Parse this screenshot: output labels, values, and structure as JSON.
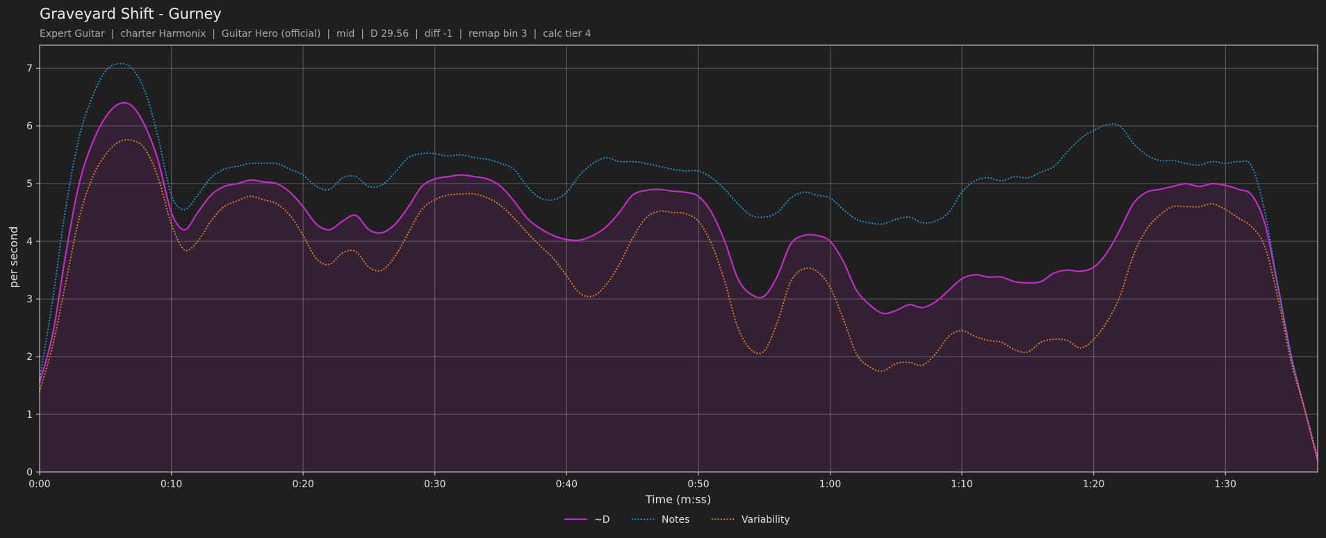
{
  "chart_data": {
    "type": "line",
    "title": "Graveyard Shift - Gurney",
    "subtitle": "Expert Guitar  |  charter Harmonix  |  Guitar Hero (official)  |  mid  |  D 29.56  |  diff -1  |  remap bin 3  |  calc tier 4",
    "xlabel": "Time (m:ss)",
    "ylabel": "per second",
    "xlim": [
      0,
      97
    ],
    "ylim": [
      0,
      7.4
    ],
    "x_ticks": [
      0,
      10,
      20,
      30,
      40,
      50,
      60,
      70,
      80,
      90
    ],
    "x_tick_labels": [
      "0:00",
      "0:10",
      "0:20",
      "0:30",
      "0:40",
      "0:50",
      "1:00",
      "1:10",
      "1:20",
      "1:30"
    ],
    "y_ticks": [
      0,
      1,
      2,
      3,
      4,
      5,
      6,
      7
    ],
    "y_tick_labels": [
      "0",
      "1",
      "2",
      "3",
      "4",
      "5",
      "6",
      "7"
    ],
    "grid": true,
    "legend_position": "bottom-center",
    "series": [
      {
        "name": "~D",
        "color": "#c22bc6",
        "style": "solid",
        "filled": true,
        "points": [
          [
            0,
            1.55
          ],
          [
            1,
            2.4
          ],
          [
            2,
            3.8
          ],
          [
            3,
            5.0
          ],
          [
            4,
            5.7
          ],
          [
            5,
            6.15
          ],
          [
            6,
            6.38
          ],
          [
            7,
            6.35
          ],
          [
            8,
            6.0
          ],
          [
            9,
            5.4
          ],
          [
            10,
            4.5
          ],
          [
            11,
            4.2
          ],
          [
            12,
            4.5
          ],
          [
            13,
            4.8
          ],
          [
            14,
            4.95
          ],
          [
            15,
            5.0
          ],
          [
            16,
            5.06
          ],
          [
            17,
            5.03
          ],
          [
            18,
            5.0
          ],
          [
            19,
            4.85
          ],
          [
            20,
            4.6
          ],
          [
            21,
            4.3
          ],
          [
            22,
            4.2
          ],
          [
            23,
            4.35
          ],
          [
            24,
            4.45
          ],
          [
            25,
            4.2
          ],
          [
            26,
            4.15
          ],
          [
            27,
            4.3
          ],
          [
            28,
            4.6
          ],
          [
            29,
            4.95
          ],
          [
            30,
            5.08
          ],
          [
            31,
            5.12
          ],
          [
            32,
            5.15
          ],
          [
            33,
            5.12
          ],
          [
            34,
            5.08
          ],
          [
            35,
            4.95
          ],
          [
            36,
            4.7
          ],
          [
            37,
            4.4
          ],
          [
            38,
            4.22
          ],
          [
            39,
            4.1
          ],
          [
            40,
            4.03
          ],
          [
            41,
            4.02
          ],
          [
            42,
            4.1
          ],
          [
            43,
            4.25
          ],
          [
            44,
            4.5
          ],
          [
            45,
            4.8
          ],
          [
            46,
            4.88
          ],
          [
            47,
            4.9
          ],
          [
            48,
            4.87
          ],
          [
            49,
            4.85
          ],
          [
            50,
            4.78
          ],
          [
            51,
            4.5
          ],
          [
            52,
            4.0
          ],
          [
            53,
            3.35
          ],
          [
            54,
            3.08
          ],
          [
            55,
            3.05
          ],
          [
            56,
            3.4
          ],
          [
            57,
            3.95
          ],
          [
            58,
            4.1
          ],
          [
            59,
            4.1
          ],
          [
            60,
            4.0
          ],
          [
            61,
            3.65
          ],
          [
            62,
            3.15
          ],
          [
            63,
            2.9
          ],
          [
            64,
            2.75
          ],
          [
            65,
            2.8
          ],
          [
            66,
            2.9
          ],
          [
            67,
            2.85
          ],
          [
            68,
            2.95
          ],
          [
            69,
            3.15
          ],
          [
            70,
            3.35
          ],
          [
            71,
            3.42
          ],
          [
            72,
            3.38
          ],
          [
            73,
            3.38
          ],
          [
            74,
            3.3
          ],
          [
            75,
            3.28
          ],
          [
            76,
            3.3
          ],
          [
            77,
            3.45
          ],
          [
            78,
            3.5
          ],
          [
            79,
            3.48
          ],
          [
            80,
            3.55
          ],
          [
            81,
            3.8
          ],
          [
            82,
            4.2
          ],
          [
            83,
            4.65
          ],
          [
            84,
            4.85
          ],
          [
            85,
            4.9
          ],
          [
            86,
            4.95
          ],
          [
            87,
            5.0
          ],
          [
            88,
            4.95
          ],
          [
            89,
            5.0
          ],
          [
            90,
            4.97
          ],
          [
            91,
            4.9
          ],
          [
            92,
            4.8
          ],
          [
            93,
            4.3
          ],
          [
            94,
            3.2
          ],
          [
            95,
            2.0
          ],
          [
            96,
            1.1
          ],
          [
            97,
            0.2
          ]
        ]
      },
      {
        "name": "Notes",
        "color": "#1f8fd1",
        "style": "dotted",
        "filled": false,
        "points": [
          [
            0,
            1.6
          ],
          [
            1,
            3.0
          ],
          [
            2,
            4.6
          ],
          [
            3,
            5.8
          ],
          [
            4,
            6.5
          ],
          [
            5,
            6.95
          ],
          [
            6,
            7.08
          ],
          [
            7,
            7.0
          ],
          [
            8,
            6.6
          ],
          [
            9,
            5.8
          ],
          [
            10,
            4.8
          ],
          [
            11,
            4.55
          ],
          [
            12,
            4.8
          ],
          [
            13,
            5.1
          ],
          [
            14,
            5.25
          ],
          [
            15,
            5.3
          ],
          [
            16,
            5.35
          ],
          [
            17,
            5.35
          ],
          [
            18,
            5.35
          ],
          [
            19,
            5.25
          ],
          [
            20,
            5.15
          ],
          [
            21,
            4.95
          ],
          [
            22,
            4.9
          ],
          [
            23,
            5.1
          ],
          [
            24,
            5.12
          ],
          [
            25,
            4.95
          ],
          [
            26,
            4.98
          ],
          [
            27,
            5.2
          ],
          [
            28,
            5.45
          ],
          [
            29,
            5.52
          ],
          [
            30,
            5.52
          ],
          [
            31,
            5.48
          ],
          [
            32,
            5.5
          ],
          [
            33,
            5.45
          ],
          [
            34,
            5.42
          ],
          [
            35,
            5.35
          ],
          [
            36,
            5.25
          ],
          [
            37,
            4.95
          ],
          [
            38,
            4.75
          ],
          [
            39,
            4.72
          ],
          [
            40,
            4.85
          ],
          [
            41,
            5.15
          ],
          [
            42,
            5.35
          ],
          [
            43,
            5.45
          ],
          [
            44,
            5.38
          ],
          [
            45,
            5.38
          ],
          [
            46,
            5.35
          ],
          [
            47,
            5.3
          ],
          [
            48,
            5.25
          ],
          [
            49,
            5.22
          ],
          [
            50,
            5.22
          ],
          [
            51,
            5.1
          ],
          [
            52,
            4.9
          ],
          [
            53,
            4.65
          ],
          [
            54,
            4.45
          ],
          [
            55,
            4.42
          ],
          [
            56,
            4.5
          ],
          [
            57,
            4.75
          ],
          [
            58,
            4.85
          ],
          [
            59,
            4.8
          ],
          [
            60,
            4.75
          ],
          [
            61,
            4.55
          ],
          [
            62,
            4.38
          ],
          [
            63,
            4.32
          ],
          [
            64,
            4.3
          ],
          [
            65,
            4.38
          ],
          [
            66,
            4.42
          ],
          [
            67,
            4.32
          ],
          [
            68,
            4.35
          ],
          [
            69,
            4.5
          ],
          [
            70,
            4.85
          ],
          [
            71,
            5.05
          ],
          [
            72,
            5.1
          ],
          [
            73,
            5.05
          ],
          [
            74,
            5.12
          ],
          [
            75,
            5.1
          ],
          [
            76,
            5.2
          ],
          [
            77,
            5.3
          ],
          [
            78,
            5.55
          ],
          [
            79,
            5.78
          ],
          [
            80,
            5.92
          ],
          [
            81,
            6.02
          ],
          [
            82,
            6.0
          ],
          [
            83,
            5.7
          ],
          [
            84,
            5.5
          ],
          [
            85,
            5.4
          ],
          [
            86,
            5.4
          ],
          [
            87,
            5.35
          ],
          [
            88,
            5.32
          ],
          [
            89,
            5.38
          ],
          [
            90,
            5.35
          ],
          [
            91,
            5.38
          ],
          [
            92,
            5.3
          ],
          [
            93,
            4.5
          ],
          [
            94,
            3.2
          ],
          [
            95,
            2.0
          ],
          [
            96,
            1.1
          ],
          [
            97,
            0.25
          ]
        ]
      },
      {
        "name": "Variability",
        "color": "#e07b28",
        "style": "dotted",
        "filled": false,
        "points": [
          [
            0,
            1.4
          ],
          [
            1,
            2.2
          ],
          [
            2,
            3.3
          ],
          [
            3,
            4.4
          ],
          [
            4,
            5.1
          ],
          [
            5,
            5.5
          ],
          [
            6,
            5.72
          ],
          [
            7,
            5.75
          ],
          [
            8,
            5.6
          ],
          [
            9,
            5.1
          ],
          [
            10,
            4.3
          ],
          [
            11,
            3.85
          ],
          [
            12,
            4.0
          ],
          [
            13,
            4.35
          ],
          [
            14,
            4.6
          ],
          [
            15,
            4.7
          ],
          [
            16,
            4.78
          ],
          [
            17,
            4.72
          ],
          [
            18,
            4.65
          ],
          [
            19,
            4.45
          ],
          [
            20,
            4.1
          ],
          [
            21,
            3.7
          ],
          [
            22,
            3.6
          ],
          [
            23,
            3.8
          ],
          [
            24,
            3.82
          ],
          [
            25,
            3.55
          ],
          [
            26,
            3.5
          ],
          [
            27,
            3.75
          ],
          [
            28,
            4.15
          ],
          [
            29,
            4.55
          ],
          [
            30,
            4.72
          ],
          [
            31,
            4.8
          ],
          [
            32,
            4.82
          ],
          [
            33,
            4.82
          ],
          [
            34,
            4.75
          ],
          [
            35,
            4.62
          ],
          [
            36,
            4.4
          ],
          [
            37,
            4.15
          ],
          [
            38,
            3.92
          ],
          [
            39,
            3.7
          ],
          [
            40,
            3.4
          ],
          [
            41,
            3.1
          ],
          [
            42,
            3.05
          ],
          [
            43,
            3.25
          ],
          [
            44,
            3.6
          ],
          [
            45,
            4.05
          ],
          [
            46,
            4.4
          ],
          [
            47,
            4.52
          ],
          [
            48,
            4.5
          ],
          [
            49,
            4.48
          ],
          [
            50,
            4.35
          ],
          [
            51,
            3.95
          ],
          [
            52,
            3.3
          ],
          [
            53,
            2.5
          ],
          [
            54,
            2.12
          ],
          [
            55,
            2.1
          ],
          [
            56,
            2.6
          ],
          [
            57,
            3.3
          ],
          [
            58,
            3.52
          ],
          [
            59,
            3.48
          ],
          [
            60,
            3.2
          ],
          [
            61,
            2.65
          ],
          [
            62,
            2.05
          ],
          [
            63,
            1.82
          ],
          [
            64,
            1.75
          ],
          [
            65,
            1.88
          ],
          [
            66,
            1.9
          ],
          [
            67,
            1.85
          ],
          [
            68,
            2.05
          ],
          [
            69,
            2.35
          ],
          [
            70,
            2.45
          ],
          [
            71,
            2.35
          ],
          [
            72,
            2.28
          ],
          [
            73,
            2.25
          ],
          [
            74,
            2.12
          ],
          [
            75,
            2.08
          ],
          [
            76,
            2.25
          ],
          [
            77,
            2.3
          ],
          [
            78,
            2.28
          ],
          [
            79,
            2.15
          ],
          [
            80,
            2.3
          ],
          [
            81,
            2.6
          ],
          [
            82,
            3.05
          ],
          [
            83,
            3.75
          ],
          [
            84,
            4.2
          ],
          [
            85,
            4.45
          ],
          [
            86,
            4.6
          ],
          [
            87,
            4.6
          ],
          [
            88,
            4.6
          ],
          [
            89,
            4.65
          ],
          [
            90,
            4.55
          ],
          [
            91,
            4.4
          ],
          [
            92,
            4.25
          ],
          [
            93,
            3.9
          ],
          [
            94,
            3.0
          ],
          [
            95,
            1.9
          ],
          [
            96,
            1.1
          ],
          [
            97,
            0.25
          ]
        ]
      }
    ]
  }
}
